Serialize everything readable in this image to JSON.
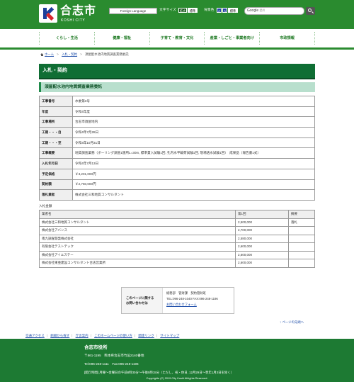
{
  "header": {
    "city_name": "合志市",
    "city_roman": "KOSHI CITY",
    "lang_button": "Foreign Language",
    "font_size_label": "文字サイズ",
    "enlarge": "拡大",
    "standard": "標準",
    "bgcolor_label": "背景色",
    "color_a1": "A",
    "color_a2": "A",
    "color_standard": "標準",
    "search_placeholder": "Google",
    "search_hint": "提供"
  },
  "gnav": [
    "くらし・生活",
    "健康・福祉",
    "子育て・教育・文化",
    "産業・しごと・事業者向け",
    "市政情報"
  ],
  "breadcrumb": {
    "home": "ホーム",
    "item2": "入札・契約",
    "sep": ">",
    "current": "須屋配水池内地質調査業務委託"
  },
  "category_title": "入札・契約",
  "page_title": "須屋配水池内地質調査業務委託",
  "details": [
    {
      "label": "工事番号",
      "value": "水委第3号"
    },
    {
      "label": "年度",
      "value": "令和4年度"
    },
    {
      "label": "工事場所",
      "value": "合志市須屋地内"
    },
    {
      "label": "工期・・・自",
      "value": "令和4年7月28日"
    },
    {
      "label": "工期・・・至",
      "value": "令和4年10月31日"
    },
    {
      "label": "工事概要",
      "value": "地質調査業務（ボーリング調査1箇所L=30m, 標準貫入試験1回, 孔内水平載荷試験1回, 現場透水試験1回）　成果品（報告書1式）"
    },
    {
      "label": "入札年月日",
      "value": "令和4年7月13日"
    },
    {
      "label": "予定価格",
      "value": "￥3,201,000円"
    },
    {
      "label": "契約額",
      "value": "￥2,750,000円"
    },
    {
      "label": "落札業者",
      "value": "株式会社三和地質コンサルタント"
    }
  ],
  "results": {
    "label": "入札金額",
    "headers": [
      "業者名",
      "第1回",
      "摘要"
    ],
    "rows": [
      [
        "株式会社三和地質コンサルタント",
        "2,500,000",
        "落札"
      ],
      [
        "株式会社アバンス",
        "2,700,000",
        ""
      ],
      [
        "南九調査開発株式会社",
        "2,580,000",
        ""
      ],
      [
        "有限会社テストテック",
        "2,600,000",
        ""
      ],
      [
        "株式会社アイエステー",
        "2,600,000",
        ""
      ],
      [
        "株式会社東亜建設コンサルタント合志営業所",
        "2,600,000",
        ""
      ]
    ]
  },
  "contact": {
    "head_line1": "このページに関する",
    "head_line2": "お問い合わせは",
    "dept": "総務部　管財課　契約管財班",
    "tel": "TEL:096-248-1040 FAX:096-248-1196",
    "form_link": "お問い合わせフォーム"
  },
  "back_top": "ページの先頭へ",
  "footer_links": [
    "交通アクセス",
    "組織から探す",
    "庁舎案内",
    "このホームページの使い方",
    "関連リンク",
    "サイトマップ"
  ],
  "footer": {
    "name": "合志市役所",
    "address": "〒861-1195　熊本県合志市竹迫2140番地",
    "tel": "Tel:096-248-1111　Fax:096-248-1196",
    "hours": "[開庁時間] 月曜～金曜日の午前8時30分～午後5時15分（ただし、祝・休日, 12月29日～翌年1月3日を除く）",
    "copyright": "Copyrights (C) 2019 City Koshi Allrights Reserved."
  }
}
